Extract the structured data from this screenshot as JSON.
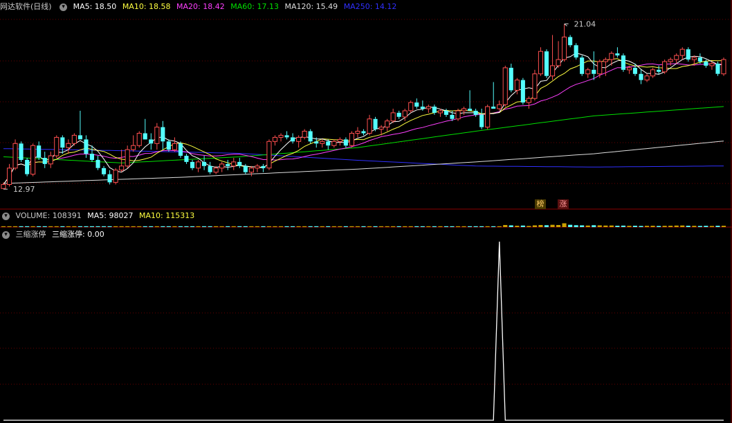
{
  "app": {
    "title": "网达软件(日线)"
  },
  "colors": {
    "up": "#ff5050",
    "down": "#54ffff",
    "ma5": "#ffffff",
    "ma10": "#ffff40",
    "ma20": "#ff40ff",
    "ma60": "#00e000",
    "ma120": "#dddddd",
    "ma250": "#3030ff",
    "grid": "#6a0000",
    "divider": "#8b0000",
    "label": "#cccccc"
  },
  "main_legend": {
    "ma5": "MA5: 18.50",
    "ma10": "MA10: 18.58",
    "ma20": "MA20: 18.42",
    "ma60": "MA60: 17.13",
    "ma120": "MA120: 15.49",
    "ma250": "MA250: 14.12"
  },
  "annotations": {
    "high": "21.04",
    "low": "12.97"
  },
  "badges": {
    "b1": "榜",
    "b2": "涨"
  },
  "volume_panel": {
    "toggle_icon": "chevron-down-icon",
    "label": "VOLUME: 108391",
    "ma5": "MA5: 98027",
    "ma10": "MA10: 115313"
  },
  "indicator_panel": {
    "toggle_icon": "chevron-down-icon",
    "name": "三缩涨停",
    "value_label": "三缩涨停: 0.00"
  },
  "chart_data": [
    {
      "type": "candlestick",
      "title": "网达软件(日线)",
      "ylim": [
        12.2,
        21.6
      ],
      "candles": [
        [
          13.0,
          13.3,
          12.97,
          13.2
        ],
        [
          13.2,
          14.2,
          13.1,
          14.0
        ],
        [
          14.0,
          15.4,
          13.9,
          15.2
        ],
        [
          15.2,
          15.3,
          14.3,
          14.4
        ],
        [
          14.4,
          14.5,
          13.6,
          13.7
        ],
        [
          13.7,
          15.2,
          13.6,
          15.1
        ],
        [
          15.1,
          15.3,
          14.4,
          14.5
        ],
        [
          14.5,
          14.8,
          14.0,
          14.2
        ],
        [
          14.2,
          14.8,
          14.0,
          14.6
        ],
        [
          14.6,
          15.6,
          14.5,
          15.5
        ],
        [
          15.5,
          15.6,
          14.7,
          15.0
        ],
        [
          15.0,
          15.4,
          14.7,
          15.2
        ],
        [
          15.2,
          15.7,
          15.1,
          15.6
        ],
        [
          15.6,
          16.8,
          15.4,
          15.4
        ],
        [
          15.4,
          15.6,
          14.5,
          14.7
        ],
        [
          14.7,
          15.1,
          14.3,
          14.4
        ],
        [
          14.4,
          14.6,
          13.9,
          14.0
        ],
        [
          14.0,
          14.1,
          13.6,
          13.7
        ],
        [
          13.7,
          13.9,
          13.2,
          13.3
        ],
        [
          13.3,
          14.0,
          13.2,
          13.9
        ],
        [
          13.9,
          14.9,
          13.8,
          14.1
        ],
        [
          14.1,
          15.1,
          14.0,
          14.9
        ],
        [
          14.9,
          15.6,
          14.8,
          15.1
        ],
        [
          15.1,
          15.8,
          15.0,
          15.7
        ],
        [
          15.7,
          16.4,
          15.6,
          15.4
        ],
        [
          15.4,
          15.7,
          14.9,
          15.2
        ],
        [
          15.2,
          16.2,
          14.9,
          16.0
        ],
        [
          16.0,
          16.3,
          14.9,
          15.3
        ],
        [
          15.3,
          15.4,
          14.8,
          14.9
        ],
        [
          14.9,
          15.5,
          14.8,
          15.2
        ],
        [
          15.2,
          15.3,
          14.5,
          14.6
        ],
        [
          14.6,
          14.7,
          14.2,
          14.3
        ],
        [
          14.3,
          14.4,
          13.9,
          14.0
        ],
        [
          14.0,
          14.4,
          13.8,
          14.3
        ],
        [
          14.3,
          14.6,
          13.9,
          14.1
        ],
        [
          14.1,
          14.3,
          13.7,
          13.8
        ],
        [
          13.8,
          14.1,
          13.7,
          14.0
        ],
        [
          14.0,
          14.3,
          13.8,
          14.2
        ],
        [
          14.2,
          14.4,
          13.9,
          14.1
        ],
        [
          14.1,
          14.5,
          13.9,
          14.3
        ],
        [
          14.3,
          14.5,
          14.0,
          14.1
        ],
        [
          14.1,
          14.2,
          13.7,
          13.8
        ],
        [
          13.8,
          14.1,
          13.6,
          14.0
        ],
        [
          14.0,
          14.2,
          13.8,
          14.1
        ],
        [
          14.1,
          14.2,
          13.8,
          14.0
        ],
        [
          14.0,
          15.4,
          13.9,
          15.3
        ],
        [
          15.3,
          15.6,
          15.1,
          15.5
        ],
        [
          15.5,
          15.7,
          15.3,
          15.6
        ],
        [
          15.6,
          15.8,
          15.4,
          15.5
        ],
        [
          15.5,
          15.7,
          15.2,
          15.3
        ],
        [
          15.3,
          15.6,
          15.0,
          15.5
        ],
        [
          15.5,
          15.9,
          15.4,
          15.8
        ],
        [
          15.8,
          15.9,
          15.2,
          15.3
        ],
        [
          15.3,
          15.5,
          15.0,
          15.2
        ],
        [
          15.2,
          15.4,
          15.0,
          15.3
        ],
        [
          15.3,
          15.4,
          14.9,
          15.1
        ],
        [
          15.1,
          15.4,
          15.0,
          15.3
        ],
        [
          15.3,
          15.5,
          15.1,
          15.4
        ],
        [
          15.4,
          15.5,
          15.0,
          15.1
        ],
        [
          15.1,
          15.8,
          15.0,
          15.7
        ],
        [
          15.7,
          16.0,
          15.5,
          15.8
        ],
        [
          15.8,
          15.9,
          15.6,
          15.7
        ],
        [
          15.7,
          16.6,
          15.6,
          16.4
        ],
        [
          16.4,
          16.5,
          15.8,
          15.9
        ],
        [
          15.9,
          16.1,
          15.6,
          16.0
        ],
        [
          16.0,
          16.4,
          15.8,
          16.3
        ],
        [
          16.3,
          16.9,
          16.2,
          16.7
        ],
        [
          16.7,
          16.8,
          16.4,
          16.5
        ],
        [
          16.5,
          16.9,
          16.3,
          16.8
        ],
        [
          16.8,
          17.3,
          16.7,
          17.2
        ],
        [
          17.2,
          17.4,
          16.9,
          17.0
        ],
        [
          17.0,
          17.3,
          16.8,
          16.9
        ],
        [
          16.9,
          17.1,
          16.7,
          17.0
        ],
        [
          17.0,
          17.1,
          16.6,
          16.7
        ],
        [
          16.7,
          16.9,
          16.5,
          16.8
        ],
        [
          16.8,
          16.9,
          16.5,
          16.6
        ],
        [
          16.6,
          16.8,
          16.3,
          16.4
        ],
        [
          16.4,
          16.9,
          16.3,
          16.8
        ],
        [
          16.8,
          17.0,
          16.6,
          16.9
        ],
        [
          16.9,
          17.8,
          16.8,
          16.8
        ],
        [
          16.8,
          16.9,
          16.5,
          16.6
        ],
        [
          16.6,
          16.9,
          15.9,
          16.0
        ],
        [
          16.0,
          17.1,
          15.9,
          17.0
        ],
        [
          17.0,
          18.2,
          16.9,
          16.9
        ],
        [
          16.9,
          17.3,
          16.8,
          17.1
        ],
        [
          17.1,
          19.0,
          17.0,
          18.9
        ],
        [
          18.9,
          19.1,
          17.7,
          17.8
        ],
        [
          17.8,
          18.4,
          17.6,
          18.3
        ],
        [
          18.3,
          18.4,
          17.1,
          17.2
        ],
        [
          17.2,
          17.5,
          16.9,
          17.4
        ],
        [
          17.4,
          18.8,
          17.3,
          18.6
        ],
        [
          18.6,
          19.9,
          18.5,
          19.7
        ],
        [
          19.7,
          19.8,
          18.4,
          18.5
        ],
        [
          18.5,
          20.5,
          18.3,
          19.0
        ],
        [
          19.0,
          20.2,
          18.9,
          19.3
        ],
        [
          19.3,
          21.04,
          19.2,
          20.4
        ],
        [
          20.4,
          20.5,
          19.9,
          20.0
        ],
        [
          20.0,
          20.1,
          19.3,
          19.4
        ],
        [
          19.4,
          19.5,
          18.5,
          18.6
        ],
        [
          18.6,
          18.9,
          18.4,
          18.8
        ],
        [
          18.8,
          19.7,
          18.3,
          18.6
        ],
        [
          18.6,
          19.3,
          18.4,
          19.2
        ],
        [
          19.2,
          19.4,
          18.5,
          19.3
        ],
        [
          19.3,
          19.7,
          19.0,
          19.6
        ],
        [
          19.6,
          19.9,
          19.4,
          19.5
        ],
        [
          19.5,
          19.6,
          18.7,
          18.8
        ],
        [
          18.8,
          19.0,
          18.6,
          18.9
        ],
        [
          18.9,
          19.1,
          18.5,
          18.6
        ],
        [
          18.6,
          18.8,
          18.1,
          18.3
        ],
        [
          18.3,
          18.6,
          18.2,
          18.5
        ],
        [
          18.5,
          18.9,
          18.4,
          18.8
        ],
        [
          18.8,
          19.0,
          18.6,
          18.7
        ],
        [
          18.7,
          19.3,
          18.6,
          19.2
        ],
        [
          19.2,
          19.4,
          19.0,
          19.3
        ],
        [
          19.3,
          19.6,
          19.1,
          19.5
        ],
        [
          19.5,
          19.9,
          19.3,
          19.8
        ],
        [
          19.8,
          19.9,
          19.2,
          19.3
        ],
        [
          19.3,
          19.5,
          19.0,
          19.4
        ],
        [
          19.4,
          19.6,
          19.1,
          19.2
        ],
        [
          19.2,
          19.3,
          18.9,
          19.0
        ],
        [
          19.0,
          19.2,
          18.8,
          19.1
        ],
        [
          19.1,
          19.2,
          18.5,
          18.6
        ],
        [
          18.6,
          19.4,
          18.5,
          19.3
        ]
      ],
      "ma60": [
        [
          0,
          14.55
        ],
        [
          20,
          14.25
        ],
        [
          40,
          14.55
        ],
        [
          60,
          15.0
        ],
        [
          80,
          15.8
        ],
        [
          100,
          16.55
        ],
        [
          128,
          17.13
        ]
      ],
      "ma120": [
        [
          0,
          13.25
        ],
        [
          30,
          13.55
        ],
        [
          60,
          13.95
        ],
        [
          80,
          14.3
        ],
        [
          100,
          14.7
        ],
        [
          128,
          15.49
        ]
      ],
      "ma250": [
        [
          0,
          14.95
        ],
        [
          20,
          14.85
        ],
        [
          40,
          14.72
        ],
        [
          60,
          14.38
        ],
        [
          80,
          14.1
        ],
        [
          100,
          14.05
        ],
        [
          128,
          14.12
        ]
      ]
    },
    {
      "type": "bar",
      "title": "VOLUME",
      "note": "volume bars, values relative to visible max",
      "values_rel": [
        0.18,
        0.15,
        0.2,
        0.18,
        0.17,
        0.16,
        0.15,
        0.14,
        0.15,
        0.16,
        0.15,
        0.14,
        0.13,
        0.16,
        0.15,
        0.14,
        0.13,
        0.12,
        0.14,
        0.13,
        0.13,
        0.14,
        0.15,
        0.14,
        0.13,
        0.14,
        0.15,
        0.14,
        0.13,
        0.12,
        0.12,
        0.11,
        0.12,
        0.11,
        0.12,
        0.11,
        0.12,
        0.11,
        0.11,
        0.12,
        0.11,
        0.11,
        0.12,
        0.12,
        0.11,
        0.18,
        0.13,
        0.14,
        0.13,
        0.12,
        0.12,
        0.13,
        0.12,
        0.12,
        0.12,
        0.11,
        0.12,
        0.12,
        0.12,
        0.13,
        0.13,
        0.12,
        0.15,
        0.13,
        0.12,
        0.13,
        0.14,
        0.13,
        0.14,
        0.14,
        0.13,
        0.13,
        0.13,
        0.12,
        0.12,
        0.12,
        0.12,
        0.13,
        0.13,
        0.16,
        0.13,
        0.14,
        0.15,
        0.18,
        0.14,
        0.55,
        0.45,
        0.35,
        0.4,
        0.3,
        0.45,
        0.55,
        0.5,
        0.6,
        0.55,
        1.0,
        0.6,
        0.5,
        0.45,
        0.4,
        0.5,
        0.45,
        0.4,
        0.42,
        0.35,
        0.38,
        0.32,
        0.35,
        0.3,
        0.32,
        0.35,
        0.3,
        0.33,
        0.35,
        0.4,
        0.42,
        0.35,
        0.33,
        0.3,
        0.32,
        0.3,
        0.35,
        0.35
      ]
    },
    {
      "type": "line",
      "title": "三缩涨停",
      "ylim": [
        0,
        1
      ],
      "spike_index": 84,
      "values_rule": "0 everywhere except 1 at spike_index"
    }
  ]
}
